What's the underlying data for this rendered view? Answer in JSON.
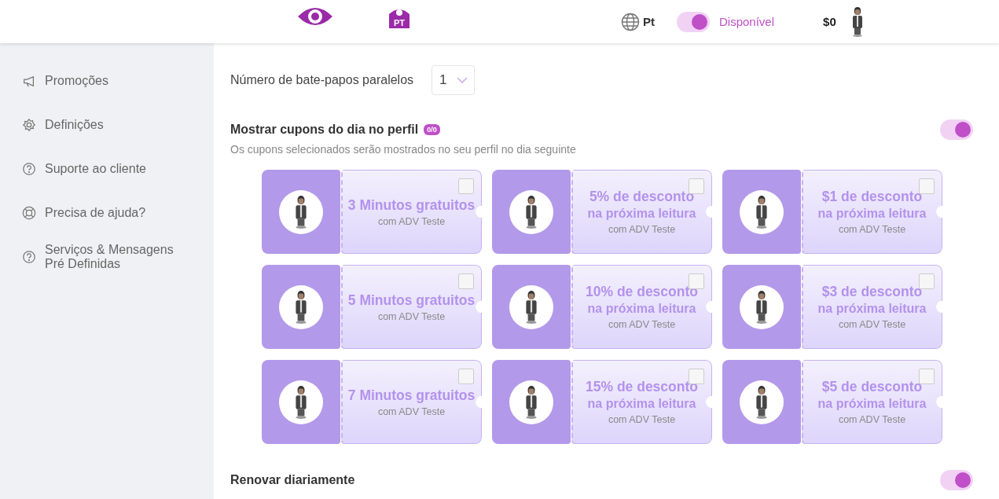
{
  "header": {
    "logo_text": "PT",
    "language": "Pt",
    "status": {
      "label": "Disponível",
      "on": true
    },
    "balance": "$0"
  },
  "sidebar": {
    "items": [
      {
        "label": "Promoções"
      },
      {
        "label": "Definições"
      },
      {
        "label": "Suporte ao cliente"
      },
      {
        "label": "Precisa de ajuda?"
      },
      {
        "label": "Serviços & Mensagens Pré Definidas"
      }
    ]
  },
  "parallel_chats": {
    "label": "Número de bate-papos paralelos",
    "value": "1"
  },
  "daily_coupons": {
    "title": "Mostrar cupons do dia no perfil",
    "badge": "0/0",
    "on": true,
    "description": "Os cupons selecionados serão mostrados no seu perfil no dia seguinte",
    "coupons": [
      {
        "title": "3 Minutos gratuitos",
        "subtitle": "com ADV Teste",
        "checked": false
      },
      {
        "title": "5% de desconto",
        "detail": "na próxima leitura",
        "subtitle": "com ADV Teste",
        "checked": false
      },
      {
        "title": "$1 de desconto",
        "detail": "na próxima leitura",
        "subtitle": "com ADV Teste",
        "checked": false
      },
      {
        "title": "5 Minutos gratuitos",
        "subtitle": "com ADV Teste",
        "checked": false
      },
      {
        "title": "10% de desconto",
        "detail": "na próxima leitura",
        "subtitle": "com ADV Teste",
        "checked": false
      },
      {
        "title": "$3 de desconto",
        "detail": "na próxima leitura",
        "subtitle": "com ADV Teste",
        "checked": false
      },
      {
        "title": "7 Minutos gratuitos",
        "subtitle": "com ADV Teste",
        "checked": false
      },
      {
        "title": "15% de desconto",
        "detail": "na próxima leitura",
        "subtitle": "com ADV Teste",
        "checked": false
      },
      {
        "title": "$5 de desconto",
        "detail": "na próxima leitura",
        "subtitle": "com ADV Teste",
        "checked": false
      }
    ]
  },
  "renew_daily": {
    "label": "Renovar diariamente",
    "on": true
  }
}
